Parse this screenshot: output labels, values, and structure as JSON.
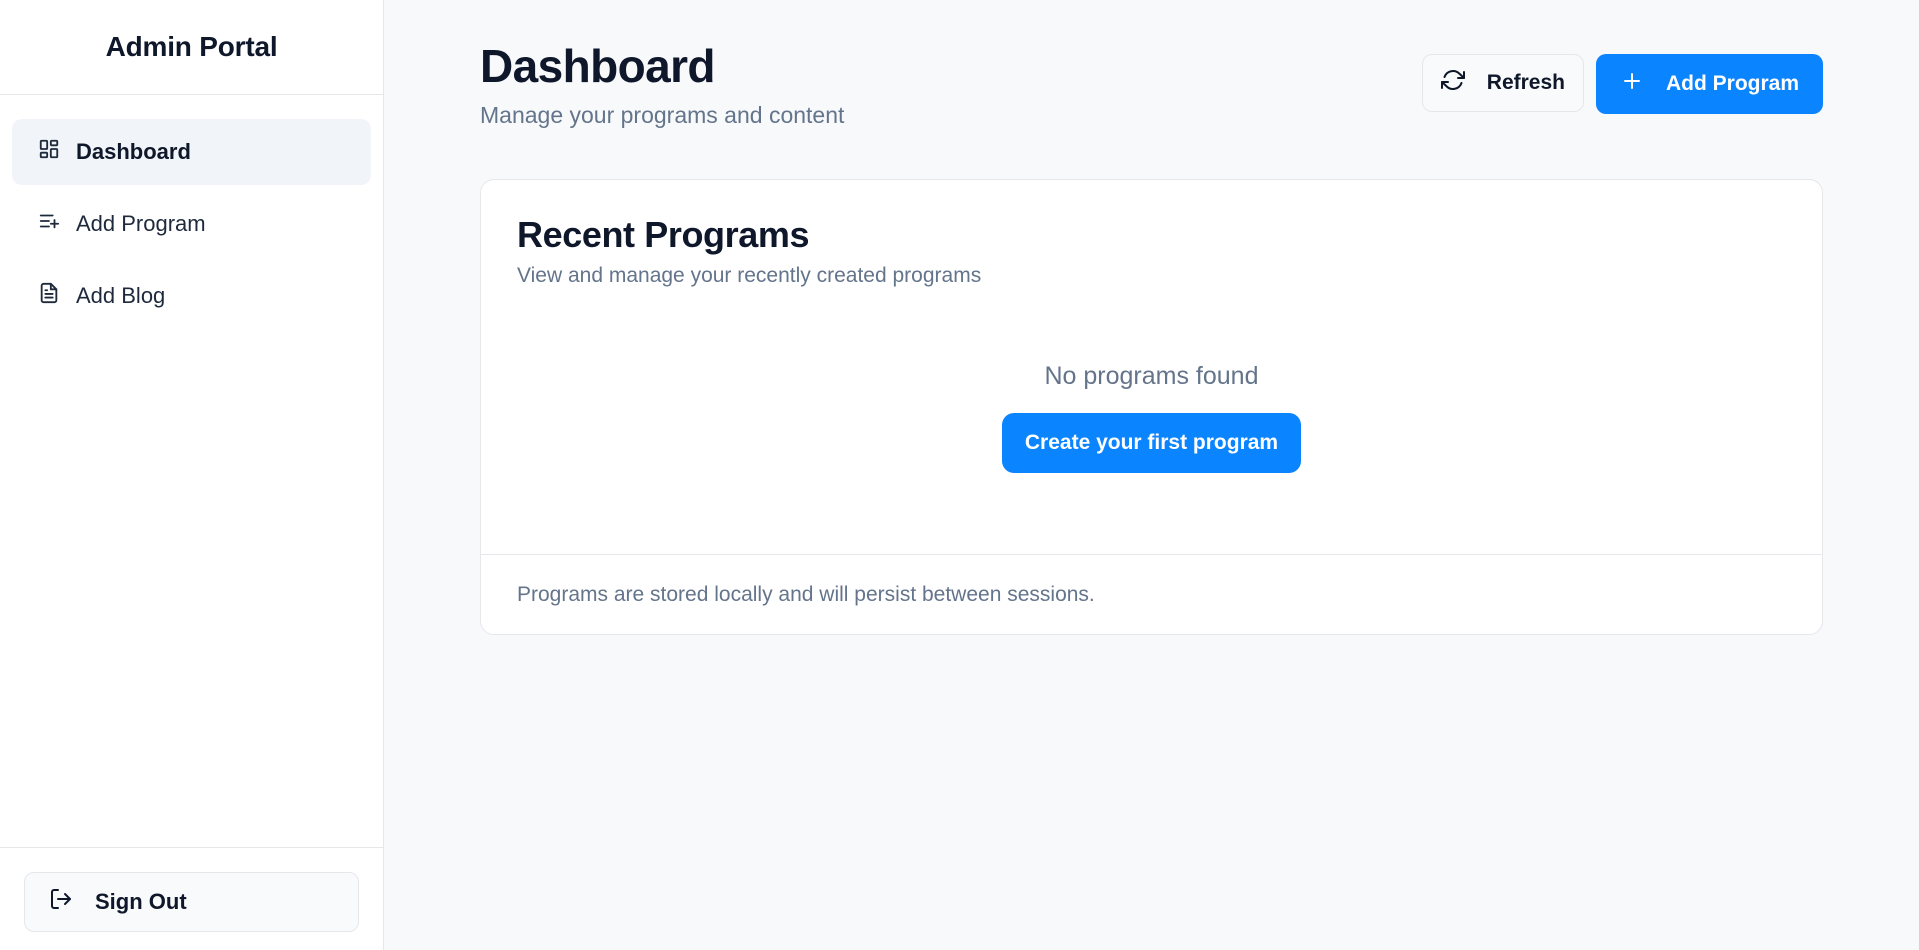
{
  "sidebar": {
    "brand": "Admin Portal",
    "items": [
      {
        "label": "Dashboard",
        "icon": "dashboard-grid-icon",
        "active": true
      },
      {
        "label": "Add Program",
        "icon": "list-plus-icon",
        "active": false
      },
      {
        "label": "Add Blog",
        "icon": "document-icon",
        "active": false
      }
    ],
    "sign_out_label": "Sign Out",
    "sign_out_icon": "logout-icon"
  },
  "header": {
    "title": "Dashboard",
    "subtitle": "Manage your programs and content",
    "refresh_label": "Refresh",
    "refresh_icon": "refresh-icon",
    "add_program_label": "Add Program",
    "add_program_icon": "plus-icon"
  },
  "recent_programs": {
    "title": "Recent Programs",
    "subtitle": "View and manage your recently created programs",
    "empty_text": "No programs found",
    "cta_label": "Create your first program",
    "footer_note": "Programs are stored locally and will persist between sessions."
  },
  "colors": {
    "primary": "#0a84ff",
    "sidebar_active_bg": "#f1f5f9",
    "muted_text": "#64748b",
    "background": "#f8f9fb"
  }
}
